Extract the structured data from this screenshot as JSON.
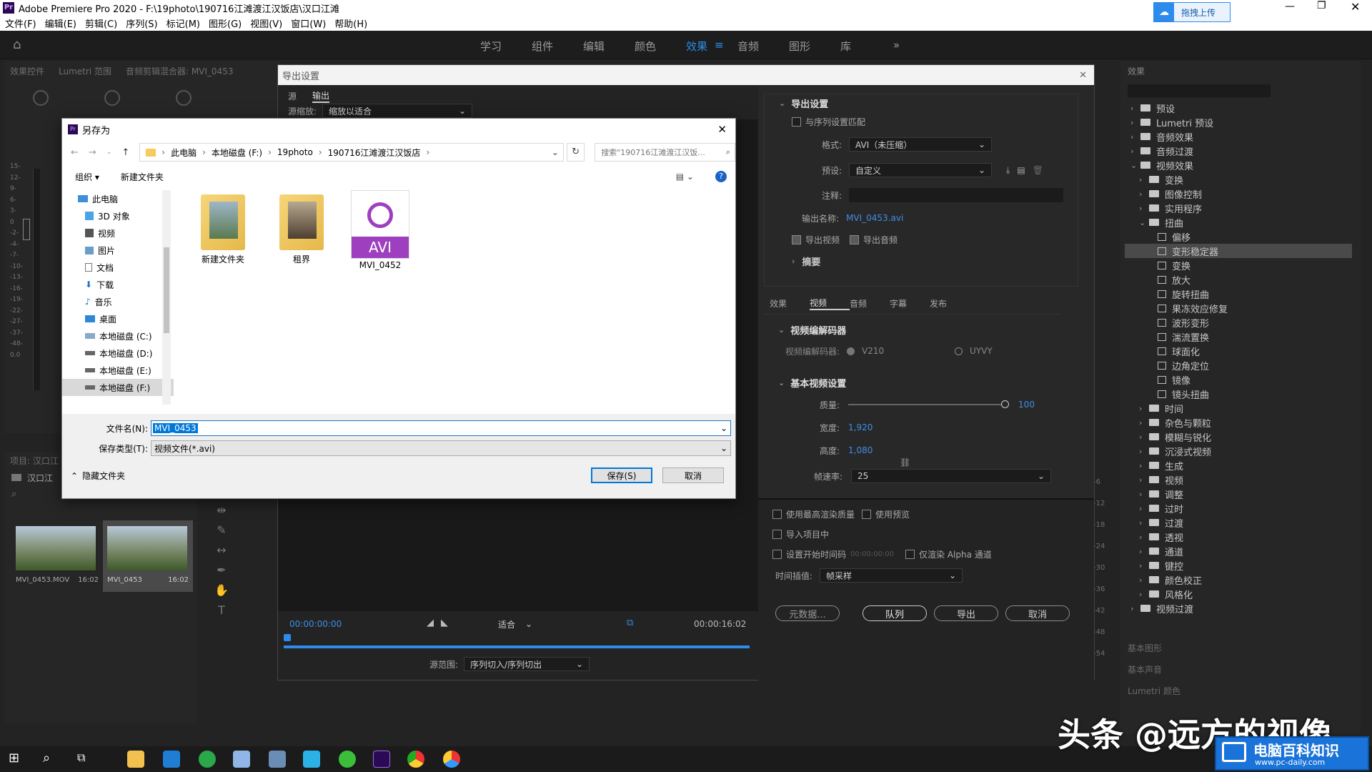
{
  "app": {
    "title": "Adobe Premiere Pro 2020 - F:\\19photo\\190716江滩渡江汉饭店\\汉口江滩",
    "logo": "Pr",
    "upload_label": "拖拽上传"
  },
  "menu": [
    "文件(F)",
    "编辑(E)",
    "剪辑(C)",
    "序列(S)",
    "标记(M)",
    "图形(G)",
    "视图(V)",
    "窗口(W)",
    "帮助(H)"
  ],
  "workspaces": [
    "学习",
    "组件",
    "编辑",
    "颜色",
    "效果",
    "音频",
    "图形",
    "库"
  ],
  "left_tabs": [
    "效果控件",
    "Lumetri 范围",
    "音频剪辑混合器: MVI_0453"
  ],
  "meter_ticks": [
    "15-",
    "12-",
    "9-",
    "6-",
    "3-",
    "0",
    "-2-",
    "-4-",
    "-7-",
    "-10-",
    "-13-",
    "-16-",
    "-19-",
    "-22-",
    "-27-",
    "-37-",
    "-48-",
    "0.0"
  ],
  "project": {
    "tab": "项目: 汉口江",
    "bin": "汉口江",
    "items": [
      {
        "name": "MVI_0453.MOV",
        "dur": "16:02"
      },
      {
        "name": "MVI_0453",
        "dur": "16:02"
      }
    ]
  },
  "export": {
    "title": "导出设置",
    "tabs": [
      "源",
      "输出"
    ],
    "source_scaling_label": "源缩放:",
    "source_scaling_value": "缩放以适合",
    "timecode_in": "00:00:00:00",
    "timecode_out": "00:00:16:02",
    "fit": "适合",
    "range_label": "源范围:",
    "range_value": "序列切入/序列切出",
    "settings": {
      "header": "导出设置",
      "match_seq": "与序列设置匹配",
      "format_label": "格式:",
      "format_value": "AVI（未压缩）",
      "preset_label": "预设:",
      "preset_value": "自定义",
      "comment_label": "注释:",
      "output_name_label": "输出名称:",
      "output_name": "MVI_0453.avi",
      "export_video": "导出视频",
      "export_audio": "导出音频",
      "summary": "摘要"
    },
    "sub_tabs": [
      "效果",
      "视频",
      "音频",
      "字幕",
      "发布"
    ],
    "codec_header": "视频编解码器",
    "codec_label": "视频编解码器:",
    "codec_opt1": "V210",
    "codec_opt2": "UYVY",
    "basic_header": "基本视频设置",
    "quality_label": "质量:",
    "quality_value": "100",
    "width_label": "宽度:",
    "width_value": "1,920",
    "height_label": "高度:",
    "height_value": "1,080",
    "fps_label": "帧速率:",
    "fps_value": "25",
    "max_quality": "使用最高渲染质量",
    "use_preview": "使用预览",
    "import_project": "导入项目中",
    "set_start_tc": "设置开始时间码",
    "start_tc": "00:00:00:00",
    "alpha_only": "仅渲染 Alpha 通道",
    "interp_label": "时间插值:",
    "interp_value": "帧采样",
    "btn_meta": "元数据...",
    "btn_queue": "队列",
    "btn_export": "导出",
    "btn_cancel": "取消"
  },
  "saveas": {
    "title": "另存为",
    "crumbs": [
      "此电脑",
      "本地磁盘 (F:)",
      "19photo",
      "190716江滩渡江汉饭店"
    ],
    "search_placeholder": "搜索\"190716江滩渡江汉饭...",
    "organize": "组织 ▾",
    "new_folder": "新建文件夹",
    "nav": [
      "此电脑",
      "3D 对象",
      "视频",
      "图片",
      "文档",
      "下载",
      "音乐",
      "桌面",
      "本地磁盘 (C:)",
      "本地磁盘 (D:)",
      "本地磁盘 (E:)",
      "本地磁盘 (F:)"
    ],
    "files": [
      {
        "name": "新建文件夹",
        "kind": "folder"
      },
      {
        "name": "租界",
        "kind": "folder"
      },
      {
        "name": "MVI_0452",
        "kind": "avi",
        "badge": "AVI"
      }
    ],
    "filename_label": "文件名(N):",
    "filename_value": "MVI_0453",
    "type_label": "保存类型(T):",
    "type_value": "视频文件(*.avi)",
    "hide_folders": "隐藏文件夹",
    "save": "保存(S)",
    "cancel": "取消"
  },
  "effects": {
    "tab": "效果",
    "tree": [
      {
        "label": "预设",
        "depth": 0,
        "kind": "folder",
        "arrow": "›"
      },
      {
        "label": "Lumetri 预设",
        "depth": 0,
        "kind": "folder",
        "arrow": "›"
      },
      {
        "label": "音频效果",
        "depth": 0,
        "kind": "folder",
        "arrow": "›"
      },
      {
        "label": "音频过渡",
        "depth": 0,
        "kind": "folder",
        "arrow": "›"
      },
      {
        "label": "视频效果",
        "depth": 0,
        "kind": "folder",
        "arrow": "⌄"
      },
      {
        "label": "变换",
        "depth": 1,
        "kind": "folder",
        "arrow": "›"
      },
      {
        "label": "图像控制",
        "depth": 1,
        "kind": "folder",
        "arrow": "›"
      },
      {
        "label": "实用程序",
        "depth": 1,
        "kind": "folder",
        "arrow": "›"
      },
      {
        "label": "扭曲",
        "depth": 1,
        "kind": "folder",
        "arrow": "⌄"
      },
      {
        "label": "偏移",
        "depth": 2,
        "kind": "preset",
        "arrow": ""
      },
      {
        "label": "变形稳定器",
        "depth": 2,
        "kind": "preset",
        "arrow": "",
        "selected": true
      },
      {
        "label": "变换",
        "depth": 2,
        "kind": "preset",
        "arrow": ""
      },
      {
        "label": "放大",
        "depth": 2,
        "kind": "preset",
        "arrow": ""
      },
      {
        "label": "旋转扭曲",
        "depth": 2,
        "kind": "preset",
        "arrow": ""
      },
      {
        "label": "果冻效应修复",
        "depth": 2,
        "kind": "preset",
        "arrow": ""
      },
      {
        "label": "波形变形",
        "depth": 2,
        "kind": "preset",
        "arrow": ""
      },
      {
        "label": "湍流置换",
        "depth": 2,
        "kind": "preset",
        "arrow": ""
      },
      {
        "label": "球面化",
        "depth": 2,
        "kind": "preset",
        "arrow": ""
      },
      {
        "label": "边角定位",
        "depth": 2,
        "kind": "preset",
        "arrow": ""
      },
      {
        "label": "镜像",
        "depth": 2,
        "kind": "preset",
        "arrow": ""
      },
      {
        "label": "镜头扭曲",
        "depth": 2,
        "kind": "preset",
        "arrow": ""
      },
      {
        "label": "时间",
        "depth": 1,
        "kind": "folder",
        "arrow": "›"
      },
      {
        "label": "杂色与颗粒",
        "depth": 1,
        "kind": "folder",
        "arrow": "›"
      },
      {
        "label": "模糊与锐化",
        "depth": 1,
        "kind": "folder",
        "arrow": "›"
      },
      {
        "label": "沉浸式视频",
        "depth": 1,
        "kind": "folder",
        "arrow": "›"
      },
      {
        "label": "生成",
        "depth": 1,
        "kind": "folder",
        "arrow": "›"
      },
      {
        "label": "视频",
        "depth": 1,
        "kind": "folder",
        "arrow": "›"
      },
      {
        "label": "调整",
        "depth": 1,
        "kind": "folder",
        "arrow": "›"
      },
      {
        "label": "过时",
        "depth": 1,
        "kind": "folder",
        "arrow": "›"
      },
      {
        "label": "过渡",
        "depth": 1,
        "kind": "folder",
        "arrow": "›"
      },
      {
        "label": "透视",
        "depth": 1,
        "kind": "folder",
        "arrow": "›"
      },
      {
        "label": "通道",
        "depth": 1,
        "kind": "folder",
        "arrow": "›"
      },
      {
        "label": "键控",
        "depth": 1,
        "kind": "folder",
        "arrow": "›"
      },
      {
        "label": "颜色校正",
        "depth": 1,
        "kind": "folder",
        "arrow": "›"
      },
      {
        "label": "风格化",
        "depth": 1,
        "kind": "folder",
        "arrow": "›"
      },
      {
        "label": "视频过渡",
        "depth": 0,
        "kind": "folder",
        "arrow": "›"
      }
    ],
    "bottom_panels": [
      "基本图形",
      "基本声音",
      "Lumetri 颜色"
    ]
  },
  "right_meter_ticks": [
    "-6",
    "-12",
    "-18",
    "-24",
    "-30",
    "-36",
    "-42",
    "-48",
    "-54"
  ],
  "watermark": {
    "text": "头条 @远方的视像",
    "badge": "电脑百科知识",
    "url": "www.pc-daily.com"
  },
  "colors": {
    "accent": "#2d8ceb",
    "selected_file": "#cce8ff"
  }
}
